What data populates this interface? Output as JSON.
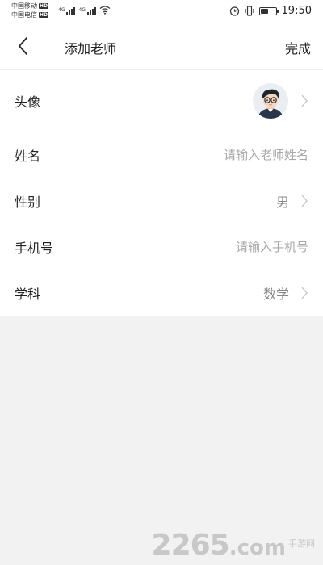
{
  "status_bar": {
    "carriers": [
      "中国移动",
      "中国电信"
    ],
    "hd_badge": "HD",
    "network_type": "4G",
    "time": "19:50",
    "battery_level": 0.5,
    "icons": [
      "signal-icon",
      "wifi-icon",
      "alarm-icon",
      "vibrate-icon",
      "battery-icon"
    ]
  },
  "header": {
    "title": "添加老师",
    "done_label": "完成",
    "back_icon": "chevron-left-icon"
  },
  "form": {
    "avatar": {
      "label": "头像"
    },
    "name": {
      "label": "姓名",
      "placeholder": "请输入老师姓名",
      "value": ""
    },
    "gender": {
      "label": "性别",
      "value": "男"
    },
    "phone": {
      "label": "手机号",
      "placeholder": "请输入手机号",
      "value": ""
    },
    "subject": {
      "label": "学科",
      "value": "数学"
    }
  },
  "watermark": {
    "number": "2265",
    "domain": "com",
    "site_name": "手游网"
  },
  "colors": {
    "background": "#f2f2f2",
    "surface": "#ffffff",
    "text_primary": "#222222",
    "text_secondary": "#888888",
    "placeholder": "#a8a8a8"
  }
}
